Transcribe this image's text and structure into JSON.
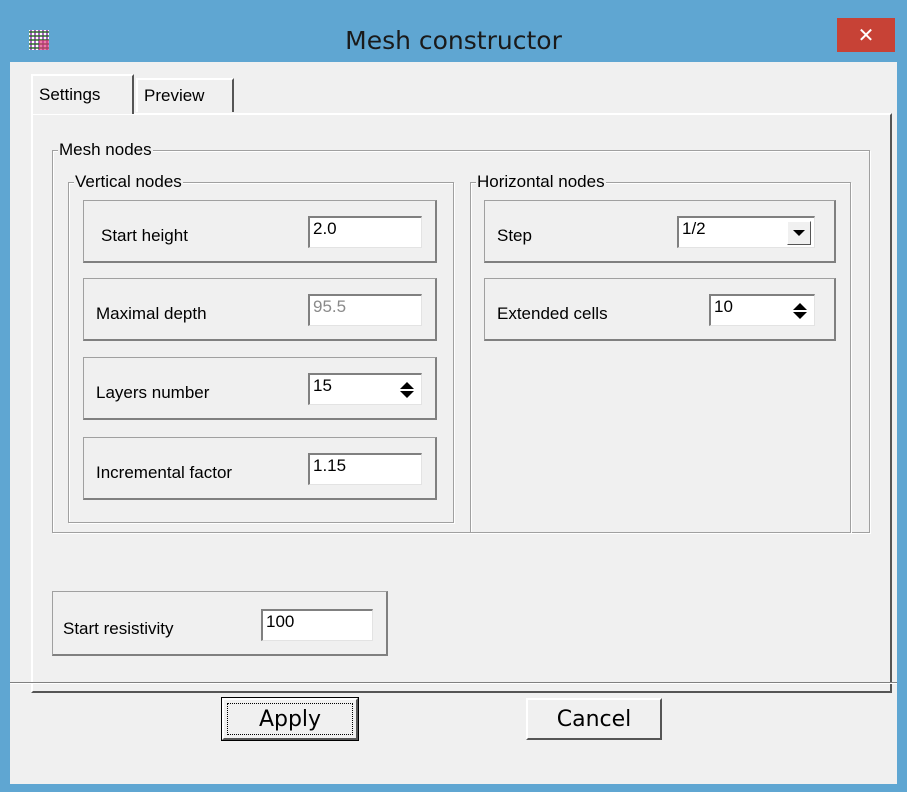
{
  "window": {
    "title": "Mesh constructor",
    "close_glyph": "✕",
    "icon": "grid-app-icon",
    "colors": {
      "frame": "#5fa6d2",
      "close": "#c74236",
      "client": "#f0f0f0"
    }
  },
  "tabs": [
    {
      "label": "Settings",
      "selected": true
    },
    {
      "label": "Preview",
      "selected": false
    }
  ],
  "mesh_nodes": {
    "label": "Mesh nodes",
    "vertical": {
      "label": "Vertical nodes",
      "start_height": {
        "label": "Start height",
        "value": "2.0"
      },
      "maximal_depth": {
        "label": "Maximal depth",
        "value": "95.5"
      },
      "layers_number": {
        "label": "Layers number",
        "value": "15"
      },
      "incremental_factor": {
        "label": "Incremental factor",
        "value": "1.15"
      }
    },
    "horizontal": {
      "label": "Horizontal nodes",
      "step": {
        "label": "Step",
        "value": "1/2"
      },
      "extended_cells": {
        "label": "Extended cells",
        "value": "10"
      }
    }
  },
  "start_resistivity": {
    "label": "Start resistivity",
    "value": "100"
  },
  "buttons": {
    "apply": "Apply",
    "cancel": "Cancel"
  }
}
